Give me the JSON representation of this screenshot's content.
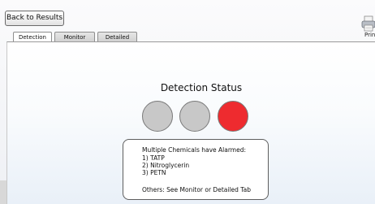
{
  "toolbar": {
    "back_label": "Back to Results",
    "print_label": "Print"
  },
  "tabs": [
    {
      "label": "Detection",
      "active": true
    },
    {
      "label": "Monitor",
      "active": false
    },
    {
      "label": "Detailed",
      "active": false
    }
  ],
  "detection": {
    "title": "Detection Status",
    "indicators": [
      {
        "state": "off",
        "color": "#c8c8c8"
      },
      {
        "state": "off",
        "color": "#c8c8c8"
      },
      {
        "state": "alarm",
        "color": "#ee2b2f"
      }
    ]
  },
  "message": {
    "heading": "Multiple Chemicals have Alarmed:",
    "items": [
      "1) TATP",
      "2) Nitroglycerin",
      "3) PETN"
    ],
    "footer": "Others:  See Monitor or Detailed Tab"
  },
  "colors": {
    "alarm": "#ee2b2f",
    "inactive": "#c8c8c8"
  },
  "icons": {
    "print": "printer-icon"
  }
}
